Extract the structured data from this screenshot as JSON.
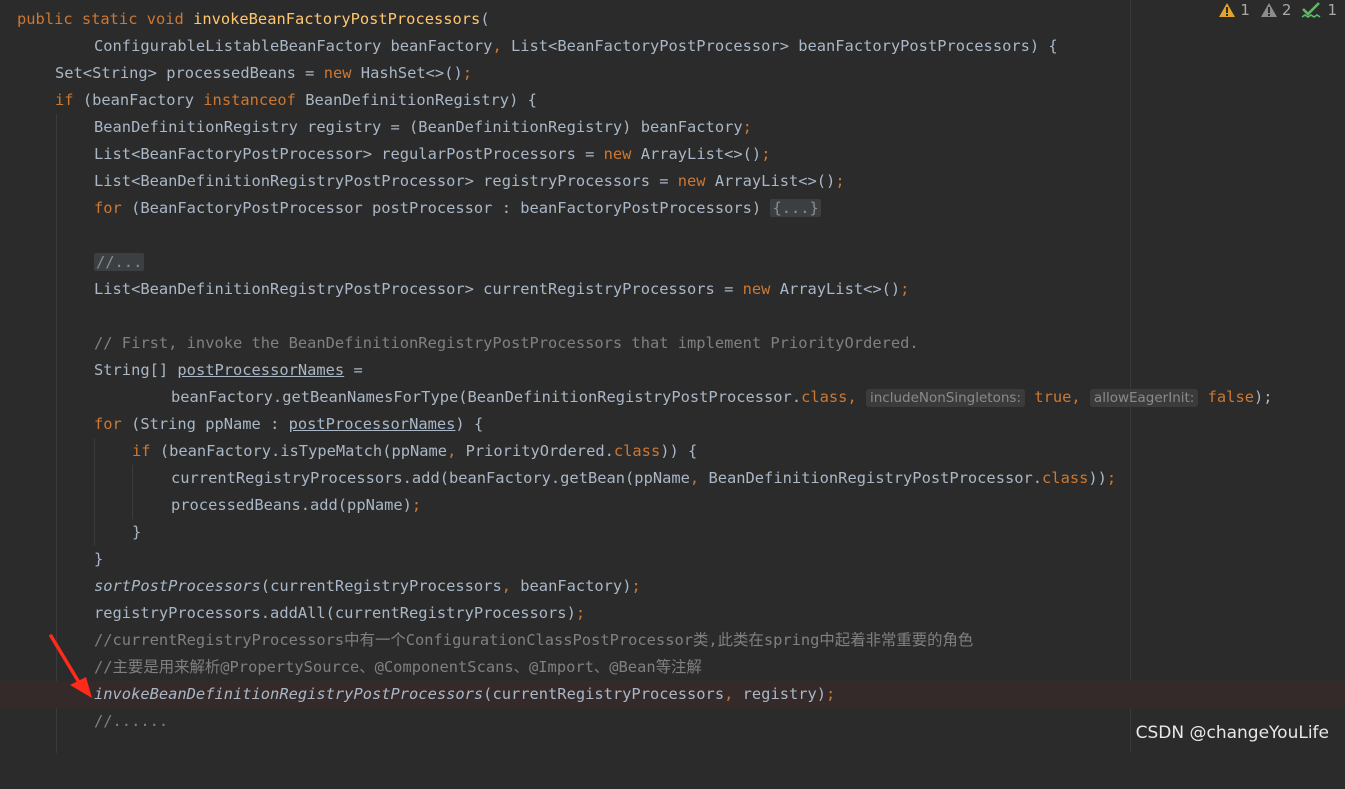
{
  "inspections": {
    "warnings": "1",
    "weak_warnings": "2",
    "typos": "1",
    "colors": {
      "warning": "#e2a52c",
      "weak_warning": "#8c8c8c",
      "typo": "#5fb865"
    }
  },
  "code": {
    "l1": {
      "a": "public static void ",
      "b": "invokeBeanFactoryPostProcessors",
      "c": "("
    },
    "l2": {
      "a": "ConfigurableListableBeanFactory beanFactory",
      "b": ", ",
      "c": "List<BeanFactoryPostProcessor> beanFactoryPostProcessors) {"
    },
    "l3": {
      "a": "Set<String> processedBeans = ",
      "b": "new ",
      "c": "HashSet<>()",
      "d": ";"
    },
    "l4": {
      "a": "if ",
      "b": "(beanFactory ",
      "c": "instanceof ",
      "d": "BeanDefinitionRegistry) {"
    },
    "l5": {
      "a": "BeanDefinitionRegistry registry = (BeanDefinitionRegistry) beanFactory",
      "b": ";"
    },
    "l6": {
      "a": "List<BeanFactoryPostProcessor> regularPostProcessors = ",
      "b": "new ",
      "c": "ArrayList<>()",
      "d": ";"
    },
    "l7": {
      "a": "List<BeanDefinitionRegistryPostProcessor> registryProcessors = ",
      "b": "new ",
      "c": "ArrayList<>()",
      "d": ";"
    },
    "l8": {
      "a": "for ",
      "b": "(BeanFactoryPostProcessor postProcessor : beanFactoryPostProcessors) ",
      "c": "{...}"
    },
    "l9": {
      "a": "//..."
    },
    "l10": {
      "a": "List<BeanDefinitionRegistryPostProcessor> currentRegistryProcessors = ",
      "b": "new ",
      "c": "ArrayList<>()",
      "d": ";"
    },
    "l11": {
      "a": "// First, invoke the BeanDefinitionRegistryPostProcessors that implement PriorityOrdered."
    },
    "l12": {
      "a": "String[] ",
      "b": "postProcessorNames",
      "c": " ="
    },
    "l13": {
      "a": "beanFactory.getBeanNamesForType(BeanDefinitionRegistryPostProcessor.",
      "b": "class",
      "c": ", ",
      "hint1": "includeNonSingletons:",
      "d": "true",
      "e": ", ",
      "hint2": "allowEagerInit:",
      "f": "false",
      "g": ");"
    },
    "l14": {
      "a": "for ",
      "b": "(String ppName : ",
      "c": "postProcessorNames",
      "d": ") {"
    },
    "l15": {
      "a": "if ",
      "b": "(beanFactory.isTypeMatch(ppName",
      "c": ", ",
      "d": "PriorityOrdered.",
      "e": "class",
      "f": ")) {"
    },
    "l16": {
      "a": "currentRegistryProcessors.add(beanFactory.getBean(ppName",
      "b": ", ",
      "c": "BeanDefinitionRegistryPostProcessor.",
      "d": "class",
      "e": "))",
      "f": ";"
    },
    "l17": {
      "a": "processedBeans.add(ppName)",
      "b": ";"
    },
    "l18": {
      "a": "}"
    },
    "l19": {
      "a": "}"
    },
    "l20": {
      "a": "sortPostProcessors",
      "b": "(currentRegistryProcessors",
      "c": ", ",
      "d": "beanFactory)",
      "e": ";"
    },
    "l21": {
      "a": "registryProcessors.addAll(currentRegistryProcessors)",
      "b": ";"
    },
    "l22": {
      "a": "//currentRegistryProcessors中有一个ConfigurationClassPostProcessor类,此类在spring中起着非常重要的角色"
    },
    "l23": {
      "a": "//主要是用来解析@PropertySource、@ComponentScans、@Import、@Bean等注解"
    },
    "l24": {
      "a": "invokeBeanDefinitionRegistryPostProcessors",
      "b": "(currentRegistryProcessors",
      "c": ", ",
      "d": "registry)",
      "e": ";"
    },
    "l25": {
      "a": "//......"
    }
  },
  "watermark": "CSDN @changeYouLife",
  "annotation_arrow_color": "#ff2a1a"
}
